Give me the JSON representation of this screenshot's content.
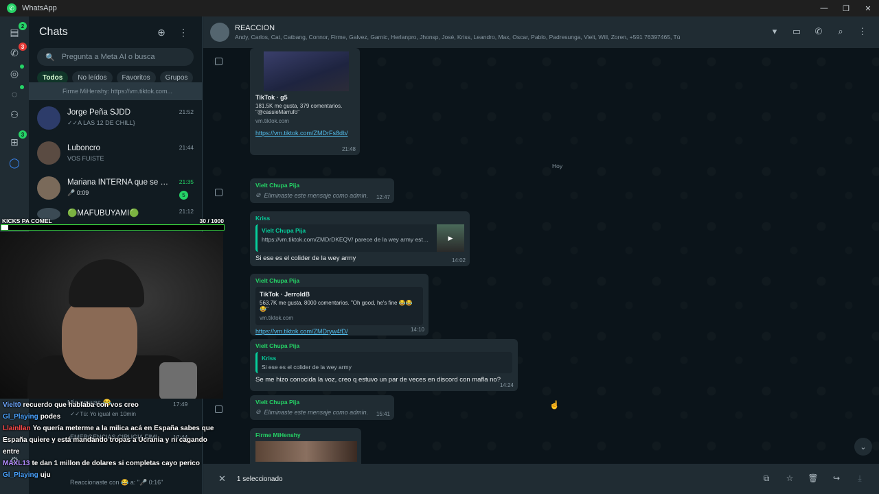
{
  "window": {
    "title": "WhatsApp"
  },
  "rail": {
    "chats_badge": "2",
    "calls_badge": "3",
    "archive_badge": "3"
  },
  "sidebar": {
    "title": "Chats",
    "search_placeholder": "Pregunta a Meta AI o busca",
    "filters": [
      "Todos",
      "No leídos",
      "Favoritos",
      "Grupos"
    ],
    "chats": [
      {
        "name": "",
        "time": "",
        "preview": "Firme MiHenshy: https://vm.tiktok.com..."
      },
      {
        "name": "Jorge Peña SJDD",
        "time": "21:52",
        "preview": "✓✓A LAS 12 DE CHILL}"
      },
      {
        "name": "Luboncro",
        "time": "21:44",
        "preview": "VOS FUISTE"
      },
      {
        "name": "Mariana INTERNA que se cre...",
        "time": "21:35",
        "preview": "🎤 0:09",
        "unread": "5"
      },
      {
        "name": "🟢MAFUBUYAMI🟢",
        "time": "21:12",
        "preview": ""
      }
    ],
    "hidden_rows": [
      {
        "preview": "Mis wawas 😂",
        "time": "17:49",
        "sub": "✓✓Tú: Yo igual en 10min"
      },
      {
        "preview": "EMERGENCIAS CIRUGIA FIMI...",
        "time": "17:44"
      },
      {
        "preview": "Reaccionaste con 😂 a: \"🎤 0:16\""
      }
    ]
  },
  "chat": {
    "group_name": "REACCION",
    "members": "Andy, Carlos, Cat, Catbang, Connor, Firme, Galvez, Garnic, Herlanpro, Jhonsp, José, Kriss, Leandro, Max, Oscar, Pablo, Padresunga, Vielt, Will, Zoren, +591 76397465, Tú",
    "day_divider": "Hoy",
    "messages": {
      "m1": {
        "title": "TikTok · g5",
        "desc": "181.5K me gusta, 379 comentarios. \"@cassieMarrufo\"",
        "domain": "vm.tiktok.com",
        "link": "https://vm.tiktok.com/ZMDrFs8db/",
        "time": "21:48"
      },
      "m2": {
        "sender": "Vielt Chupa Pija",
        "text": "Eliminaste este mensaje como admin.",
        "time": "12:47"
      },
      "m3": {
        "sender": "Kriss",
        "quote_name": "Vielt Chupa Pija",
        "quote_text": "https://vm.tiktok.com/ZMDrDKEQV/ parece de la wey army este peji",
        "text": "Si ese es el colider de la wey army",
        "time": "14:02"
      },
      "m4": {
        "sender": "Vielt Chupa Pija",
        "title": "TikTok · JerroldB",
        "desc": "563.7K me gusta, 8000 comentarios. \"Oh good, he's fine 😂😂😂\"",
        "domain": "vm.tiktok.com",
        "link": "https://vm.tiktok.com/ZMDryw4fD/",
        "time": "14:10"
      },
      "m5": {
        "sender": "Vielt Chupa Pija",
        "quote_name": "Kriss",
        "quote_text": "Si ese es el colider de la wey army",
        "text": "Se me hizo conocida la voz, creo q estuvo un par de veces en discord con mafla no?",
        "time": "14:24"
      },
      "m6": {
        "sender": "Vielt Chupa Pija",
        "text": "Eliminaste este mensaje como admin.",
        "time": "15:41"
      },
      "m7": {
        "sender": "Firme MiHenshy"
      }
    }
  },
  "selection": {
    "count_label": "1 seleccionado"
  },
  "overlay": {
    "title": "KICKS PA COMEL",
    "count": "30  / 1000",
    "progress": 0.03,
    "feed": [
      {
        "user": "Vielt0",
        "color": "#6ea8ff",
        "msg": "recuerdo que hablaba con vos creo"
      },
      {
        "user": "Gl_Playing",
        "color": "#4aa3ff",
        "msg": "podes"
      },
      {
        "user": "Llainllan",
        "color": "#ff4b4b",
        "msg": "Yo quería meterme a la milica acá en España sabes que España quiere y está mandando tropas a Ucrania y ni cagando entre"
      },
      {
        "user": "MAXL13",
        "color": "#b48cff",
        "msg": "te dan 1 millon de dolares si completas cayo perico"
      },
      {
        "user": "Gl_Playing",
        "color": "#4aa3ff",
        "msg": "uju"
      }
    ]
  }
}
